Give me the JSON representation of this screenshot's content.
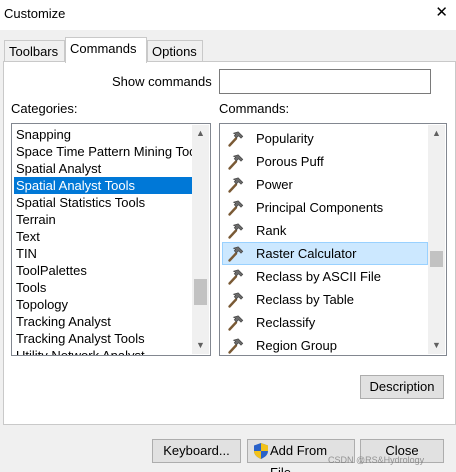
{
  "window": {
    "title": "Customize",
    "close_glyph": "✕"
  },
  "tabs": [
    {
      "label": "Toolbars",
      "active": false
    },
    {
      "label": "Commands",
      "active": true
    },
    {
      "label": "Options",
      "active": false
    }
  ],
  "show_commands": {
    "label": "Show commands",
    "value": ""
  },
  "categories": {
    "label": "Categories:",
    "items": [
      "Snapping",
      "Space Time Pattern Mining Toc",
      "Spatial Analyst",
      "Spatial Analyst Tools",
      "Spatial Statistics Tools",
      "Terrain",
      "Text",
      "TIN",
      "ToolPalettes",
      "Tools",
      "Topology",
      "Tracking Analyst",
      "Tracking Analyst Tools",
      "Utility Network Analyst"
    ],
    "selected": "Spatial Analyst Tools",
    "scroll_position": 0.8
  },
  "commands": {
    "label": "Commands:",
    "items": [
      {
        "label": "Popularity",
        "icon": "hammer-icon"
      },
      {
        "label": "Porous Puff",
        "icon": "hammer-icon"
      },
      {
        "label": "Power",
        "icon": "hammer-icon"
      },
      {
        "label": "Principal Components",
        "icon": "hammer-icon"
      },
      {
        "label": "Rank",
        "icon": "hammer-icon"
      },
      {
        "label": "Raster Calculator",
        "icon": "hammer-icon"
      },
      {
        "label": "Reclass by ASCII File",
        "icon": "hammer-icon"
      },
      {
        "label": "Reclass by Table",
        "icon": "hammer-icon"
      },
      {
        "label": "Reclassify",
        "icon": "hammer-icon"
      },
      {
        "label": "Region Group",
        "icon": "hammer-icon"
      }
    ],
    "selected": "Raster Calculator",
    "scroll_position": 0.6
  },
  "buttons": {
    "description": "Description",
    "keyboard": "Keyboard...",
    "add_from_file": "Add From File...",
    "close": "Close"
  },
  "watermark": "CSDN @RS&Hydrology",
  "colors": {
    "selection_blue": "#0078d7",
    "command_highlight": "#cce8ff"
  }
}
